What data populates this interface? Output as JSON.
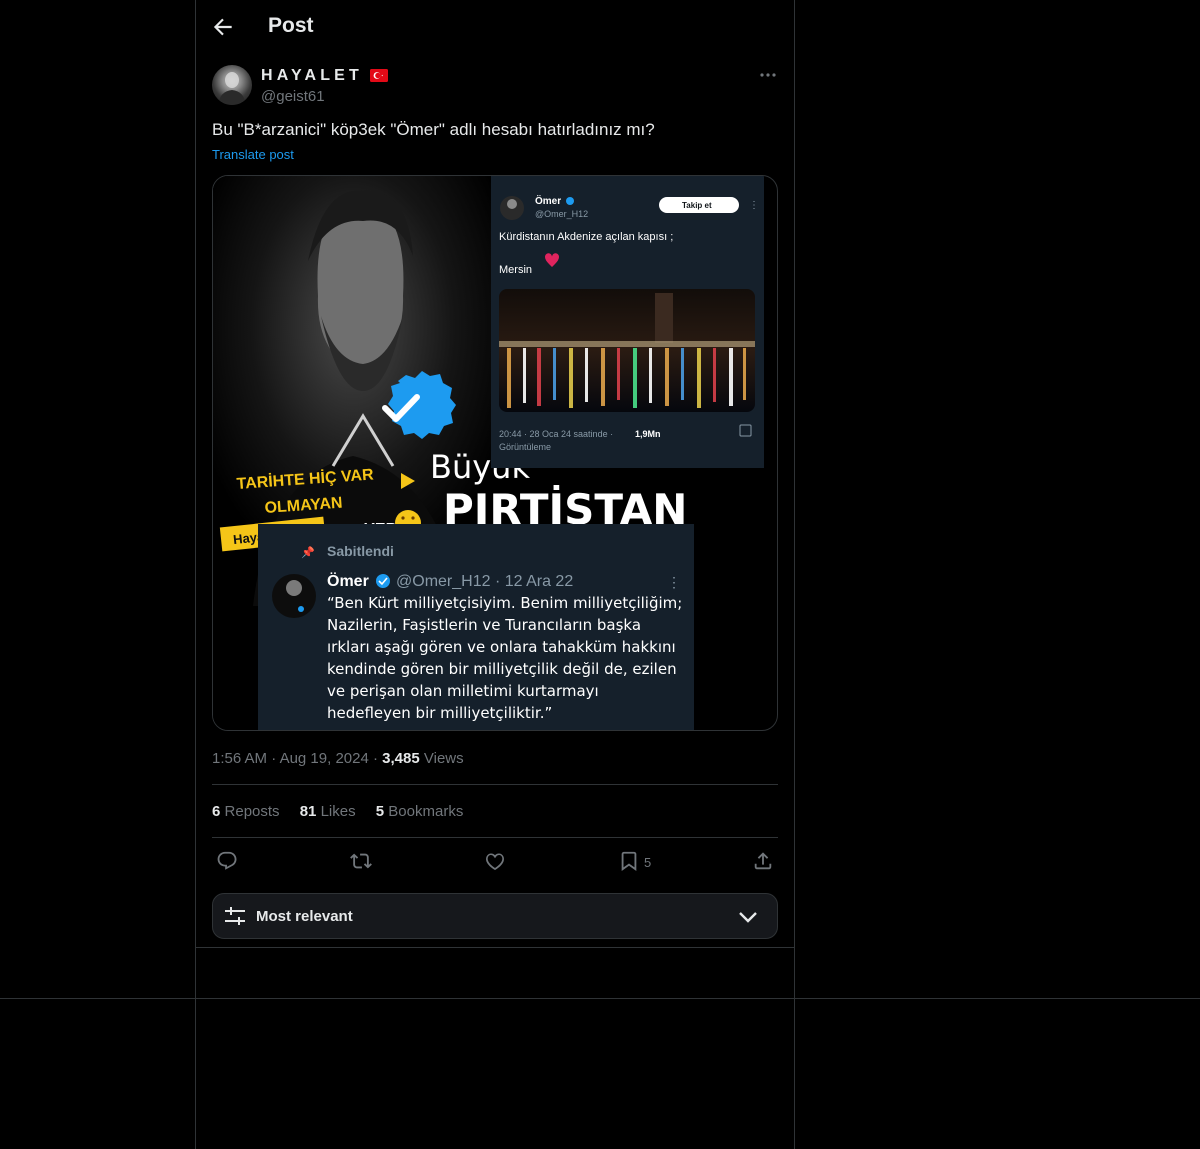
{
  "header": {
    "title": "Post"
  },
  "author": {
    "display_name": "HAYALET",
    "handle": "@geist61"
  },
  "post": {
    "text": "Bu \"B*arzanici\" köp3ek \"Ömer\" adlı hesabı hatırladınız mı?",
    "translate_label": "Translate post",
    "time": "1:56 AM",
    "date": "Aug 19, 2024",
    "views_count": "3,485",
    "views_label": "Views"
  },
  "media": {
    "overlay_left_line1": "TARİHTE HİÇ VAR",
    "overlay_left_line2": "OLMAYAN",
    "overlay_tag": "Hayali Bir",
    "overlay_yer": "YER",
    "big_line1": "Büyük",
    "big_line2": "PIRTİSTAN",
    "inner_tweet_top": {
      "name": "Ömer",
      "handle": "@Omer_H12",
      "follow_label": "Takip et",
      "line1": "Kürdistanın Akdenize açılan kapısı ;",
      "line2": "Mersin",
      "footer_time": "20:44 · 28 Oca 24 saatinde ·",
      "footer_views": "1,9Mn",
      "footer_label": "Görüntüleme"
    },
    "inner_tweet_bottom": {
      "pinned_label": "Sabitlendi",
      "name": "Ömer",
      "handle_date": "@Omer_H12 · 12 Ara 22",
      "lines": [
        "“Ben Kürt milliyetçisiyim. Benim milliyetçiliğim;",
        "Nazilerin, Faşistlerin ve Turancıların başka",
        "ırkları aşağı gören ve onlara tahakküm hakkını",
        "kendinde gören bir milliyetçilik değil de, ezilen",
        "ve perişan olan milletimi kurtarmayı",
        "hedefleyen bir milliyetçiliktir.”"
      ]
    }
  },
  "stats": {
    "reposts_count": "6",
    "reposts_label": "Reposts",
    "likes_count": "81",
    "likes_label": "Likes",
    "bookmarks_count": "5",
    "bookmarks_label": "Bookmarks"
  },
  "actions": {
    "bookmark_count": "5"
  },
  "replies": {
    "sort_label": "Most relevant"
  },
  "colors": {
    "accent": "#1d9bf0",
    "border": "#2f3336",
    "muted": "#71767b",
    "text": "#e7e9ea"
  }
}
